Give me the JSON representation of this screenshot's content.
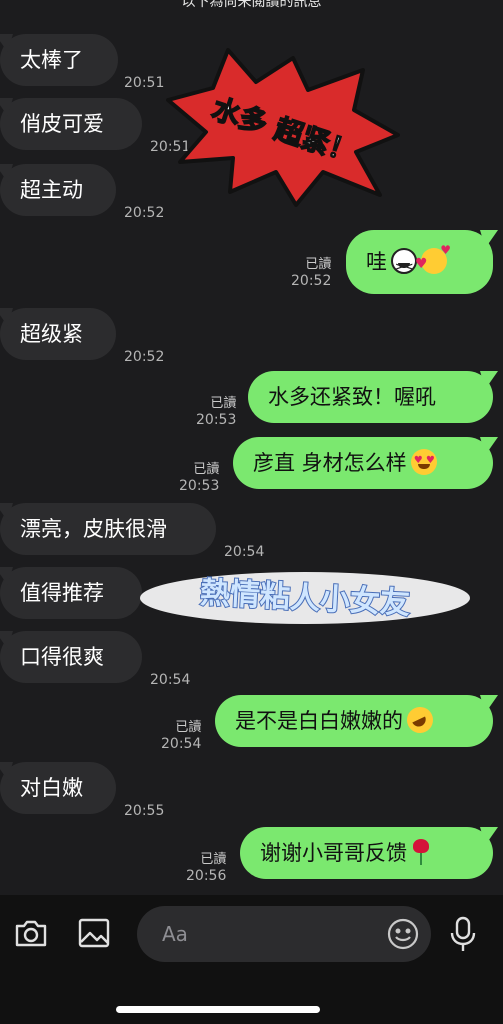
{
  "divider": {
    "text": "以下為尚未閱讀的訊息"
  },
  "messages": [
    {
      "dir": "in",
      "text": "太棒了",
      "time": "20:51"
    },
    {
      "dir": "in",
      "text": "俏皮可爱",
      "time": "20:51"
    },
    {
      "dir": "in",
      "text": "超主动",
      "time": "20:52"
    },
    {
      "dir": "out",
      "text": "哇",
      "time": "20:52",
      "read": "已讀",
      "emoji": [
        "grinning-squint-face-emoji",
        "smiling-face-with-hearts-emoji"
      ]
    },
    {
      "dir": "in",
      "text": "超级紧",
      "time": "20:52"
    },
    {
      "dir": "out",
      "text": "水多还紧致！喔吼",
      "time": "20:53",
      "read": "已讀"
    },
    {
      "dir": "out",
      "text": "彦直 身材怎么样",
      "time": "20:53",
      "read": "已讀",
      "emoji": [
        "heart-eyes-emoji"
      ]
    },
    {
      "dir": "in",
      "text": "漂亮，皮肤很滑",
      "time": "20:54"
    },
    {
      "dir": "in",
      "text": "值得推荐",
      "time": ""
    },
    {
      "dir": "in",
      "text": "口得很爽",
      "time": "20:54"
    },
    {
      "dir": "out",
      "text": "是不是白白嫩嫩的",
      "time": "20:54",
      "read": "已讀",
      "emoji": [
        "rolling-laughing-emoji"
      ]
    },
    {
      "dir": "in",
      "text": "对白嫩",
      "time": "20:55"
    },
    {
      "dir": "out",
      "text": "谢谢小哥哥反馈",
      "time": "20:56",
      "read": "已讀",
      "emoji": [
        "rose-emoji"
      ]
    }
  ],
  "stickers": {
    "burst": {
      "text": "水多 超紧！",
      "colors": {
        "fill": "#d92b2b",
        "outline": "#111111"
      }
    },
    "banner": {
      "text": "熱情粘人小女友",
      "colors": {
        "fill": "#cfe6ff",
        "stroke": "#4a6fb8"
      }
    }
  },
  "toolbar": {
    "camera_icon": "camera-icon",
    "image_icon": "image-icon",
    "input_placeholder": "Aa",
    "emoji_icon": "smiley-icon",
    "mic_icon": "microphone-icon"
  },
  "colors": {
    "background": "#1c1c1e",
    "incoming": "#2c2c2e",
    "outgoing": "#7be86f"
  }
}
